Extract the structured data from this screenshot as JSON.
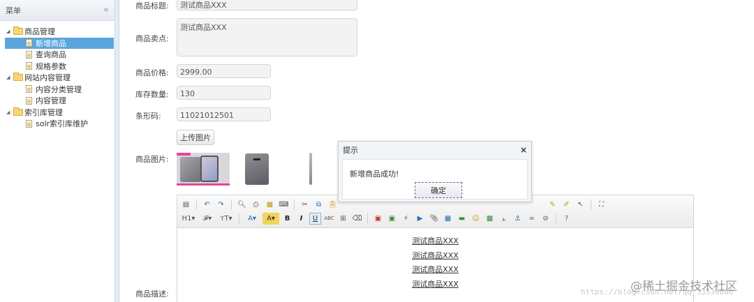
{
  "sidebar": {
    "title": "菜单",
    "collapse_icon": "«",
    "tree": [
      {
        "label": "商品管理",
        "type": "folder"
      },
      {
        "label": "新增商品",
        "type": "file",
        "selected": true
      },
      {
        "label": "查询商品",
        "type": "file"
      },
      {
        "label": "规格参数",
        "type": "file"
      },
      {
        "label": "网站内容管理",
        "type": "folder"
      },
      {
        "label": "内容分类管理",
        "type": "file"
      },
      {
        "label": "内容管理",
        "type": "file"
      },
      {
        "label": "索引库管理",
        "type": "folder"
      },
      {
        "label": "solr索引库维护",
        "type": "file"
      }
    ]
  },
  "form": {
    "title_label": "商品标题:",
    "title_value": "测试商品XXX",
    "sellpoint_label": "商品卖点:",
    "sellpoint_value": "测试商品XXX",
    "price_label": "商品价格:",
    "price_value": "2999.00",
    "stock_label": "库存数量:",
    "stock_value": "130",
    "barcode_label": "条形码:",
    "barcode_value": "11021012501",
    "upload_label": "上传图片",
    "image_label": "商品图片:",
    "desc_label": "商品描述:"
  },
  "editor": {
    "row1": [
      "源码",
      "撤销",
      "重做",
      "预览",
      "打印",
      "模板",
      "代码",
      "剪切",
      "复制",
      "粘贴"
    ],
    "row2": [
      "H1",
      "字体",
      "字号",
      "文字颜色",
      "背景颜色",
      "B",
      "I",
      "U",
      "删除线",
      "表格",
      "清除"
    ],
    "lines": [
      "测试商品XXX",
      "测试商品XXX",
      "测试商品XXX",
      "测试商品XXX"
    ]
  },
  "dialog": {
    "title": "提示",
    "close": "×",
    "message": "新增商品成功!",
    "ok_label": "确定"
  },
  "watermark": {
    "url": "https://blog.csdn.net/qq_33530866",
    "brand": "@稀土掘金技术社区"
  }
}
